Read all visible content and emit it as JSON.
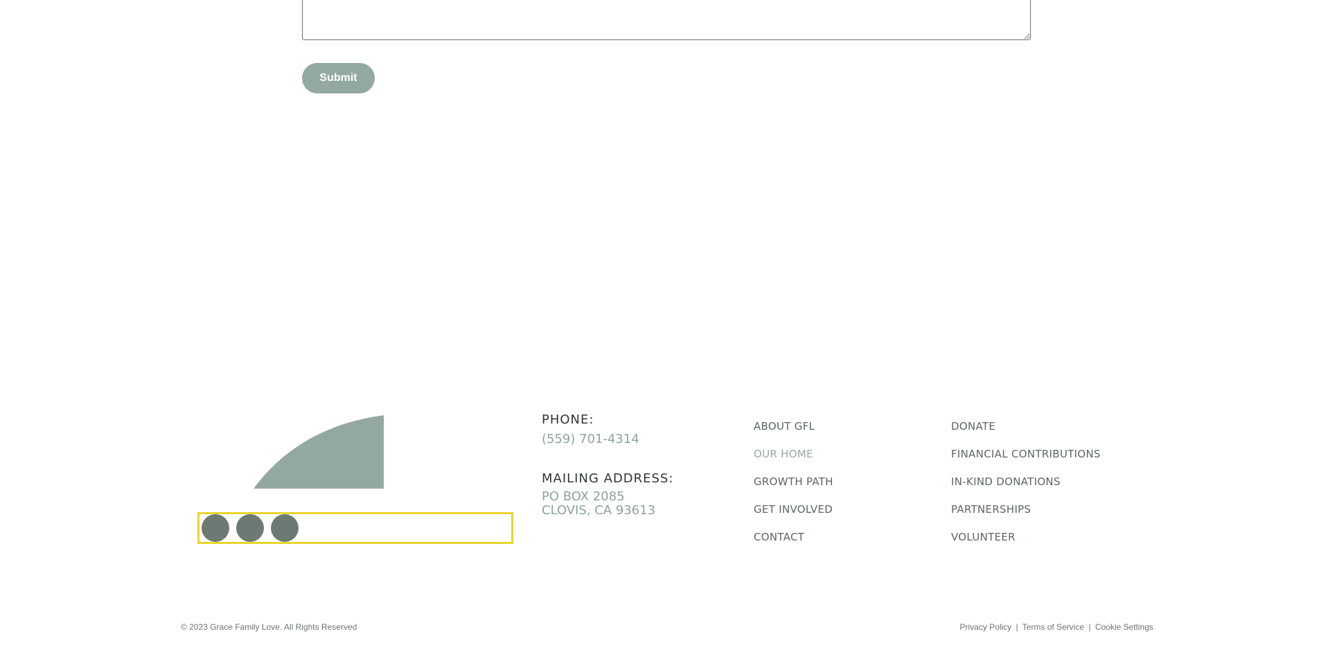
{
  "form": {
    "textarea_value": "",
    "submit_label": "Submit",
    "submit_color": "#93a8a0"
  },
  "footer": {
    "logo": {
      "icon": "leaf-logo",
      "color": "#93a8a0"
    },
    "social": {
      "highlight_color": "#e8d42e",
      "icons": [
        "social-icon",
        "social-icon",
        "social-icon"
      ]
    },
    "contact": {
      "phone_label": "PHONE:",
      "phone_value": "(559) 701-4314",
      "mail_label": "MAILING ADDRESS:",
      "mail_line1": "PO BOX 2085",
      "mail_line2": "CLOVIS, CA 93613"
    },
    "nav_col1": [
      "ABOUT GFL",
      "OUR HOME",
      "GROWTH PATH",
      "GET INVOLVED",
      "CONTACT"
    ],
    "nav_col2": [
      "DONATE",
      "FINANCIAL CONTRIBUTIONS",
      "IN-KIND DONATIONS",
      "PARTNERSHIPS",
      "VOLUNTEER"
    ],
    "active_nav": "OUR HOME",
    "copyright": "© 2023 Grace Family Love. All Rights Reserved",
    "legal": {
      "privacy": "Privacy Policy",
      "sep": "|",
      "terms": "Terms of Service",
      "cookies": "Cookie Settings"
    }
  }
}
